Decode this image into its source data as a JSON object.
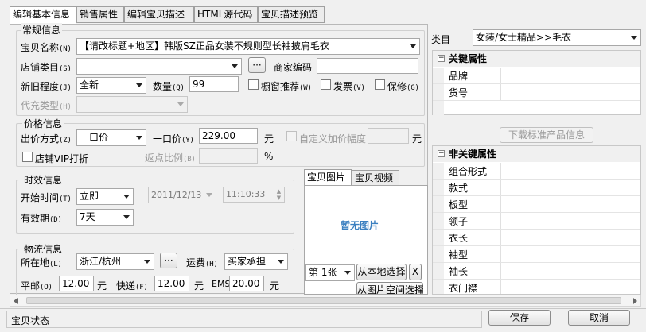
{
  "tabs": [
    "编辑基本信息",
    "销售属性",
    "编辑宝贝描述",
    "HTML源代码",
    "宝贝描述预览"
  ],
  "general": {
    "title": "常规信息",
    "name_label": "宝贝名称",
    "name_hk": "(N)",
    "name_value": "【请改标题+地区】韩版SZ正品女装不规则型长袖披肩毛衣",
    "store_cat_label": "店铺类目",
    "store_cat_hk": "(S)",
    "store_cat_value": "",
    "more_btn": "···",
    "merchant_code_label": "商家编码",
    "merchant_code_value": "",
    "condition_label": "新旧程度",
    "condition_hk": "(J)",
    "condition_value": "全新",
    "qty_label": "数量",
    "qty_hk": "(Q)",
    "qty_value": "99",
    "window_rec_label": "橱窗推荐",
    "window_rec_hk": "(W)",
    "invoice_label": "发票",
    "invoice_hk": "(V)",
    "warranty_label": "保修",
    "warranty_hk": "(G)",
    "recharge_label": "代充类型",
    "recharge_hk": "(H)"
  },
  "price": {
    "title": "价格信息",
    "method_label": "出价方式",
    "method_hk": "(Z)",
    "method_value": "一口价",
    "fixed_label": "一口价",
    "fixed_hk": "(Y)",
    "fixed_value": "229.00",
    "unit": "元",
    "custom_label": "自定义加价幅度",
    "custom_unit": "元",
    "vip_label": "店铺VIP打折",
    "rebate_label": "返点比例",
    "rebate_hk": "(B)",
    "percent": "%"
  },
  "timing": {
    "title": "时效信息",
    "start_label": "开始时间",
    "start_hk": "(T)",
    "start_value": "立即",
    "date_value": "2011/12/13",
    "time_value": "11:10:33",
    "valid_label": "有效期",
    "valid_hk": "(D)",
    "valid_value": "7天"
  },
  "logistics": {
    "title": "物流信息",
    "location_label": "所在地",
    "location_hk": "(L)",
    "location_value": "浙江/杭州",
    "freight_label": "运费",
    "freight_hk": "(H)",
    "freight_value": "买家承担",
    "mail_label": "平邮",
    "mail_hk": "(O)",
    "mail_value": "12.00",
    "express_label": "快递",
    "express_hk": "(F)",
    "express_value": "12.00",
    "ems_label": "EMS",
    "ems_value": "20.00",
    "unit": "元"
  },
  "image_panel": {
    "tabs": [
      "宝贝图片",
      "宝贝视频"
    ],
    "empty_text": "暂无图片",
    "index_value": "第 1张",
    "local_btn": "从本地选择",
    "remove_btn": "X",
    "space_btn": "从图片空间选择"
  },
  "category": {
    "label": "类目",
    "value": "女装/女士精品>>毛衣"
  },
  "key_props": {
    "title": "关键属性",
    "rows": [
      "品牌",
      "货号"
    ]
  },
  "download_btn": "下载标准产品信息",
  "nonkey_props": {
    "title": "非关键属性",
    "rows": [
      "组合形式",
      "款式",
      "板型",
      "领子",
      "衣长",
      "袖型",
      "袖长",
      "衣门襟"
    ]
  },
  "status": {
    "label": "宝贝状态",
    "save": "保存",
    "cancel": "取消"
  },
  "colors": {
    "accent_blue": "#3a7fc0"
  }
}
